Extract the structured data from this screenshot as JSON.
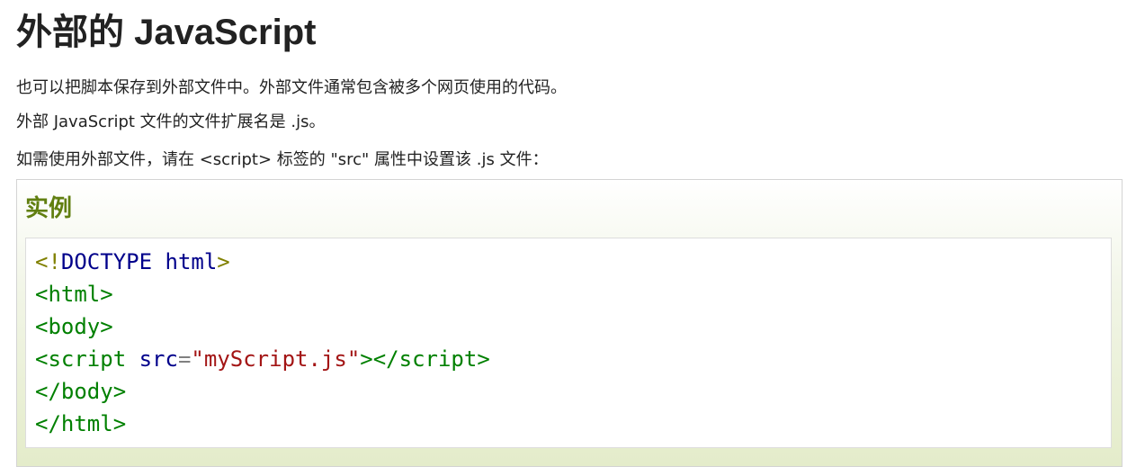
{
  "title": "外部的 JavaScript",
  "paragraphs": [
    "也可以把脚本保存到外部文件中。外部文件通常包含被多个网页使用的代码。",
    "外部 JavaScript 文件的文件扩展名是 .js。",
    "如需使用外部文件，请在 <script> 标签的 \"src\" 属性中设置该 .js 文件："
  ],
  "example": {
    "heading": "实例",
    "code": {
      "line1": {
        "open": "<!",
        "keyword": "DOCTYPE html",
        "close": ">"
      },
      "line2": {
        "open": "<",
        "tag": "html",
        "close": ">"
      },
      "line3": {
        "open": "<",
        "tag": "body",
        "close": ">"
      },
      "line4": {
        "open": "<",
        "tag": "script",
        "space": " ",
        "attr": "src",
        "eq": "=",
        "value": "\"myScript.js\"",
        "mid": "></",
        "closetag": "script",
        "close": ">"
      },
      "line5": {
        "open": "</",
        "tag": "body",
        "close": ">"
      },
      "line6": {
        "open": "</",
        "tag": "html",
        "close": ">"
      }
    }
  },
  "colors": {
    "heading_green": "#617f10",
    "code_tag": "#008000",
    "code_bracket": "#808000",
    "code_attr": "#00008b",
    "code_string": "#a31515"
  }
}
